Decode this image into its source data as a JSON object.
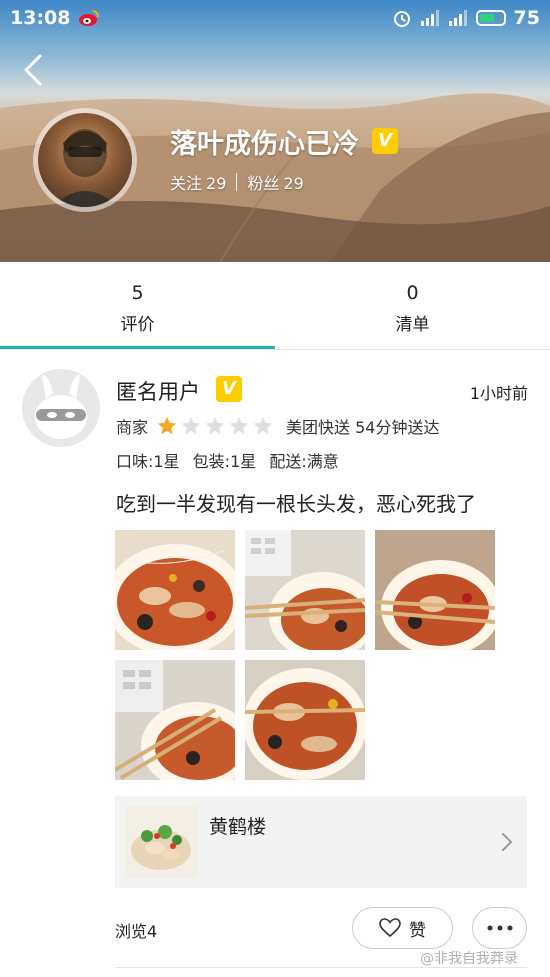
{
  "status_bar": {
    "time": "13:08",
    "battery": "75",
    "icons": [
      "weibo-icon",
      "alarm-icon",
      "signal-icon",
      "signal-icon",
      "battery-icon"
    ]
  },
  "profile": {
    "name": "落叶成伤心已冷",
    "badge": "V",
    "following_label": "关注",
    "following_count": "29",
    "fans_label": "粉丝",
    "fans_count": "29"
  },
  "tabs": [
    {
      "count": "5",
      "label": "评价",
      "active": true
    },
    {
      "count": "0",
      "label": "清单",
      "active": false
    }
  ],
  "review": {
    "user": "匿名用户",
    "badge": "V",
    "time": "1小时前",
    "merchant_label": "商家",
    "stars": 1,
    "stars_max": 5,
    "delivery": "美团快送 54分钟送达",
    "taste": "口味:1星",
    "packaging": "包装:1星",
    "service": "配送:满意",
    "text": "吃到一半发现有一根长头发，恶心死我了",
    "photo_count": 5
  },
  "restaurant": {
    "name": "黄鹤楼"
  },
  "footer": {
    "views": "浏览4",
    "like_label": "赞",
    "watermark": "@非我自我莽录"
  },
  "colors": {
    "accent": "#1fb6b1",
    "star_on": "#f5a623",
    "star_off": "#e0e0e0",
    "badge": "#ffcc00"
  }
}
